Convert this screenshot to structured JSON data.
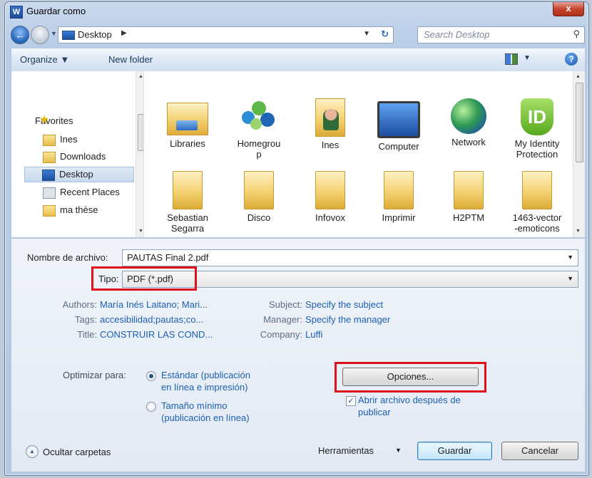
{
  "window": {
    "app_icon": "W",
    "title": "Guardar como",
    "close_label": "x"
  },
  "address": {
    "location": "Desktop",
    "search_placeholder": "Search Desktop"
  },
  "toolbar": {
    "organize": "Organize ▼",
    "new_folder": "New folder"
  },
  "sidebar": {
    "items": [
      {
        "label": "Favorites",
        "icon": "star-icon"
      },
      {
        "label": "Ines",
        "icon": "user-folder-icon"
      },
      {
        "label": "Downloads",
        "icon": "downloads-icon"
      },
      {
        "label": "Desktop",
        "icon": "desktop-icon",
        "selected": true
      },
      {
        "label": "Recent Places",
        "icon": "recent-places-icon"
      },
      {
        "label": "ma thèse",
        "icon": "folder-icon"
      }
    ]
  },
  "files": [
    {
      "label": "Libraries",
      "icon": "libraries-icon"
    },
    {
      "label": "Homegrou\np",
      "icon": "homegroup-icon"
    },
    {
      "label": "Ines",
      "icon": "user-folder-icon"
    },
    {
      "label": "Computer",
      "icon": "computer-icon"
    },
    {
      "label": "Network",
      "icon": "network-icon"
    },
    {
      "label": "My Identity\nProtection",
      "icon": "identity-shortcut-icon"
    },
    {
      "label": "Sebastian\nSegarra",
      "icon": "folder-icon"
    },
    {
      "label": "Disco",
      "icon": "folder-icon"
    },
    {
      "label": "Infovox",
      "icon": "folder-icon"
    },
    {
      "label": "Imprimir",
      "icon": "folder-icon"
    },
    {
      "label": "H2PTM",
      "icon": "folder-icon"
    },
    {
      "label": "1463-vector\n-emoticons",
      "icon": "folder-icon"
    }
  ],
  "form": {
    "filename_label": "Nombre de archivo:",
    "filename_value": "PAUTAS Final 2.pdf",
    "type_label": "Tipo:",
    "type_value": "PDF (*.pdf)",
    "authors_label": "Authors:",
    "authors_value": "María Inés Laitano; Mari...",
    "tags_label": "Tags:",
    "tags_value": "accesibilidad;pautas;co...",
    "title_label": "Title:",
    "title_value": "CONSTRUIR LAS COND...",
    "subject_label": "Subject:",
    "subject_value": "Specify the subject",
    "manager_label": "Manager:",
    "manager_value": "Specify the manager",
    "company_label": "Company:",
    "company_value": "Luffi",
    "optimize_label": "Optimizar para:",
    "opt_standard": "Estándar (publicación\nen línea e impresión)",
    "opt_minimum": "Tamaño mínimo\n(publicación en línea)",
    "options_button": "Opciones...",
    "open_after": "Abrir archivo después de\npublicar",
    "hide_folders": "Ocultar carpetas",
    "tools": "Herramientas",
    "save": "Guardar",
    "cancel": "Cancelar"
  },
  "colors": {
    "highlight_box": "#e0101a",
    "link_blue": "#1b5fb4"
  }
}
